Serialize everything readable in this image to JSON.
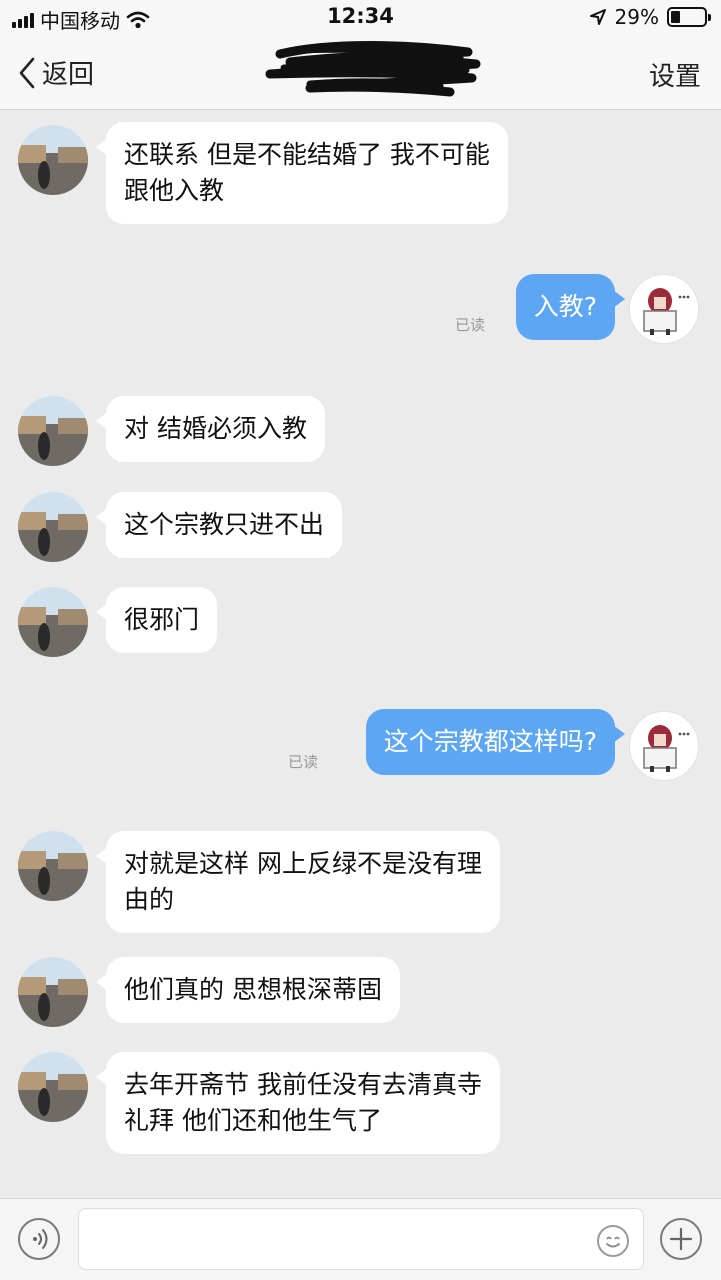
{
  "status_bar": {
    "carrier": "中国移动",
    "time": "12:34",
    "battery": "29%",
    "battery_level": 0.29,
    "icons": [
      "signal-icon",
      "wifi-icon",
      "location-arrow-icon",
      "battery-icon"
    ]
  },
  "nav": {
    "back_label": "返回",
    "title": "",
    "settings_label": "设置"
  },
  "read_label": "已读",
  "messages": [
    {
      "from": "them",
      "line1": "还联系 但是不能结婚了 我不可能",
      "line2": "跟他入教"
    },
    {
      "from": "me",
      "text": "入教?",
      "status": "已读"
    },
    {
      "from": "them",
      "line1": "对 结婚必须入教"
    },
    {
      "from": "them",
      "line1": "这个宗教只进不出"
    },
    {
      "from": "them",
      "line1": "很邪门"
    },
    {
      "from": "me",
      "text": "这个宗教都这样吗?",
      "status": "已读"
    },
    {
      "from": "them",
      "line1": "对就是这样 网上反绿不是没有理",
      "line2": "由的"
    },
    {
      "from": "them",
      "line1": "他们真的 思想根深蒂固"
    },
    {
      "from": "them",
      "line1": "去年开斋节 我前任没有去清真寺",
      "line2": "礼拜 他们还和他生气了"
    }
  ],
  "input_bar": {
    "placeholder": "",
    "icons": [
      "voice-icon",
      "emoji-icon",
      "plus-icon"
    ]
  },
  "colors": {
    "outgoing_bubble": "#5da6f3",
    "incoming_bubble": "#ffffff",
    "background": "#ebebeb"
  }
}
